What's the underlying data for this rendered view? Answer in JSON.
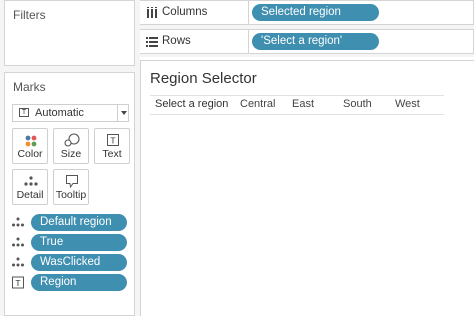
{
  "filters": {
    "title": "Filters"
  },
  "marks": {
    "title": "Marks",
    "mark_type": "Automatic",
    "buttons": [
      {
        "label": "Color",
        "icon": "color-dots-icon"
      },
      {
        "label": "Size",
        "icon": "size-circles-icon"
      },
      {
        "label": "Text",
        "icon": "text-t-icon"
      },
      {
        "label": "Detail",
        "icon": "detail-dots-icon"
      },
      {
        "label": "Tooltip",
        "icon": "tooltip-bubble-icon"
      }
    ],
    "fields": [
      {
        "label": "Default region",
        "icon": "detail-dots-icon"
      },
      {
        "label": "True",
        "icon": "detail-dots-icon"
      },
      {
        "label": "WasClicked",
        "icon": "detail-dots-icon"
      },
      {
        "label": "Region",
        "icon": "text-t-icon"
      }
    ]
  },
  "shelves": {
    "columns": {
      "label": "Columns",
      "pill": "Selected region"
    },
    "rows": {
      "label": "Rows",
      "pill": "'Select a region'"
    }
  },
  "view": {
    "title": "Region Selector",
    "headers": [
      "Select a region",
      "Central",
      "East",
      "South",
      "West"
    ]
  },
  "colors": {
    "pill": "#3f8fb1",
    "panel": "#f5f5f5"
  }
}
